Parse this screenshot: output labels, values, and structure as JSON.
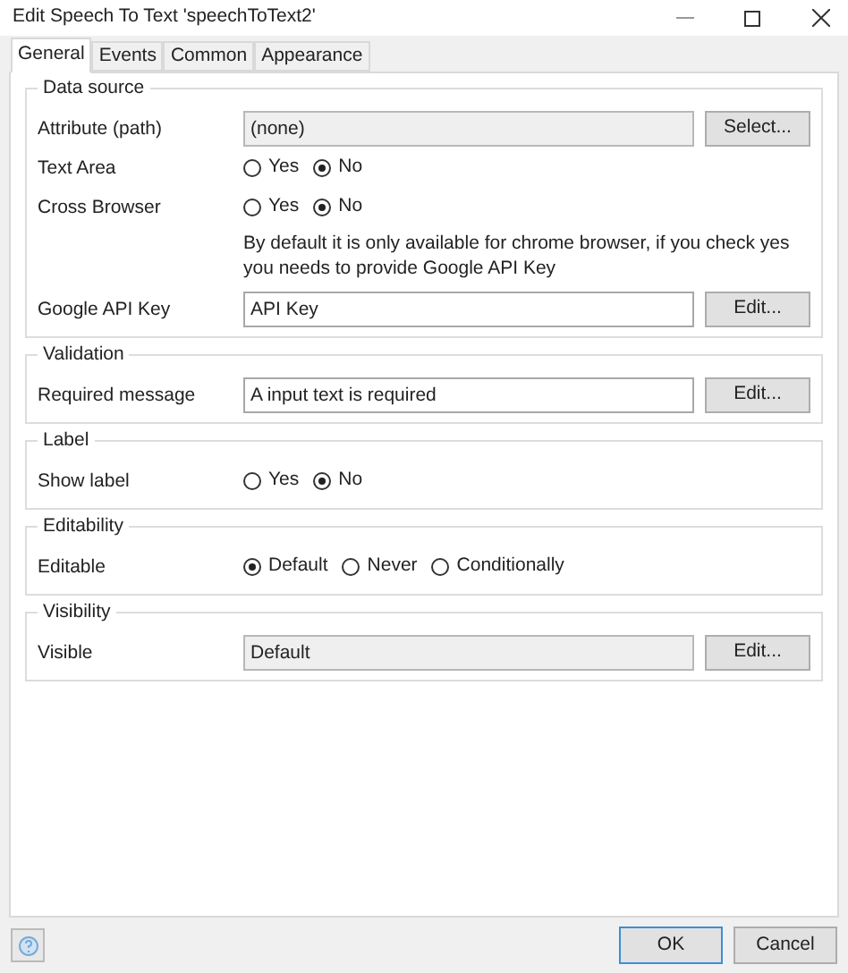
{
  "window": {
    "title": "Edit Speech To Text 'speechToText2'"
  },
  "tabs": [
    {
      "label": "General",
      "selected": true
    },
    {
      "label": "Events",
      "selected": false
    },
    {
      "label": "Common",
      "selected": false
    },
    {
      "label": "Appearance",
      "selected": false
    }
  ],
  "sections": [
    {
      "title": "Data source",
      "rows": [
        {
          "label": "Attribute (path)",
          "kind": "field",
          "value": "(none)",
          "disabled": true,
          "button": "Select..."
        },
        {
          "label": "Text Area",
          "kind": "radio",
          "options": [
            {
              "label": "Yes",
              "selected": false
            },
            {
              "label": "No",
              "selected": true
            }
          ]
        },
        {
          "label": "Cross Browser",
          "kind": "radio",
          "options": [
            {
              "label": "Yes",
              "selected": false
            },
            {
              "label": "No",
              "selected": true
            }
          ],
          "note": "By default it is only available for chrome browser, if you check yes you needs to provide Google API Key"
        },
        {
          "label": "Google API Key",
          "kind": "field",
          "value": "API Key",
          "disabled": false,
          "button": "Edit..."
        }
      ]
    },
    {
      "title": "Validation",
      "rows": [
        {
          "label": "Required message",
          "kind": "field",
          "value": "A input text is required",
          "disabled": false,
          "button": "Edit..."
        }
      ]
    },
    {
      "title": "Label",
      "rows": [
        {
          "label": "Show label",
          "kind": "radio",
          "options": [
            {
              "label": "Yes",
              "selected": false
            },
            {
              "label": "No",
              "selected": true
            }
          ]
        }
      ]
    },
    {
      "title": "Editability",
      "rows": [
        {
          "label": "Editable",
          "kind": "radio",
          "options": [
            {
              "label": "Default",
              "selected": true
            },
            {
              "label": "Never",
              "selected": false
            },
            {
              "label": "Conditionally",
              "selected": false
            }
          ]
        }
      ]
    },
    {
      "title": "Visibility",
      "rows": [
        {
          "label": "Visible",
          "kind": "field",
          "value": "Default",
          "disabled": true,
          "button": "Edit..."
        }
      ]
    }
  ],
  "buttons": [
    {
      "label": "OK",
      "default": true
    },
    {
      "label": "Cancel",
      "default": false
    }
  ]
}
